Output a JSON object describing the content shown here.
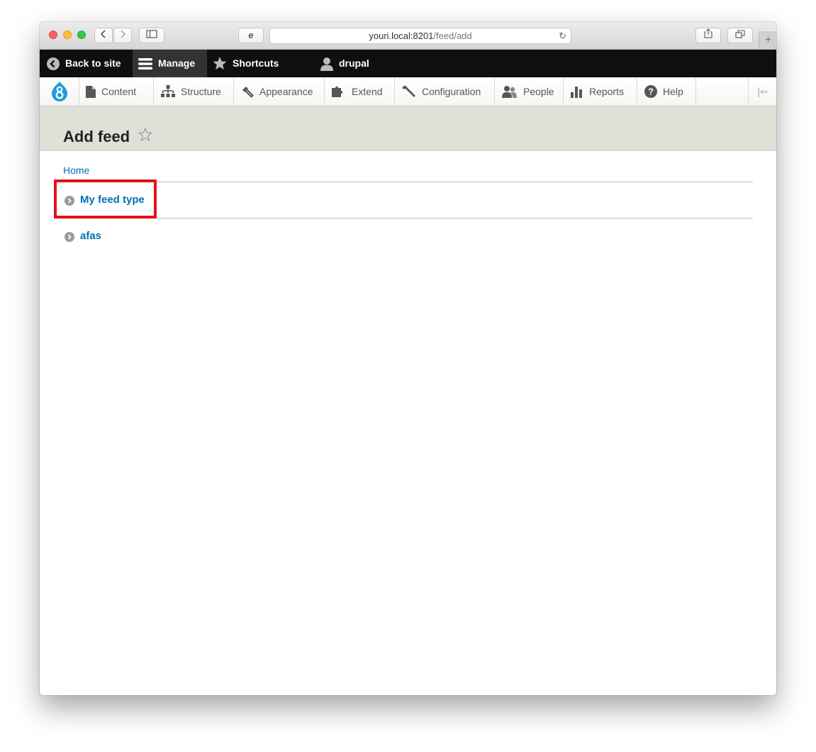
{
  "browser": {
    "url_host": "youri.local:8201",
    "url_path": "/feed/add",
    "colors": {
      "close": "#fc605c",
      "minimize": "#fdbc40",
      "maximize": "#34c84a"
    }
  },
  "admin_toolbar": {
    "back_to_site": "Back to site",
    "manage": "Manage",
    "shortcuts": "Shortcuts",
    "user": "drupal"
  },
  "admin_menu": {
    "items": [
      {
        "label": "Content",
        "icon": "document-icon"
      },
      {
        "label": "Structure",
        "icon": "sitemap-icon"
      },
      {
        "label": "Appearance",
        "icon": "paintbrush-icon"
      },
      {
        "label": "Extend",
        "icon": "puzzle-icon"
      },
      {
        "label": "Configuration",
        "icon": "wrench-icon"
      },
      {
        "label": "People",
        "icon": "people-icon"
      },
      {
        "label": "Reports",
        "icon": "bar-chart-icon"
      },
      {
        "label": "Help",
        "icon": "help-icon"
      }
    ]
  },
  "page": {
    "title": "Add feed",
    "breadcrumb": "Home",
    "feed_types": [
      {
        "label": "My feed type"
      },
      {
        "label": "afas"
      }
    ]
  },
  "colors": {
    "link": "#0071b3",
    "highlight_box": "#e8101a",
    "header_bg": "#e0e0d8"
  }
}
